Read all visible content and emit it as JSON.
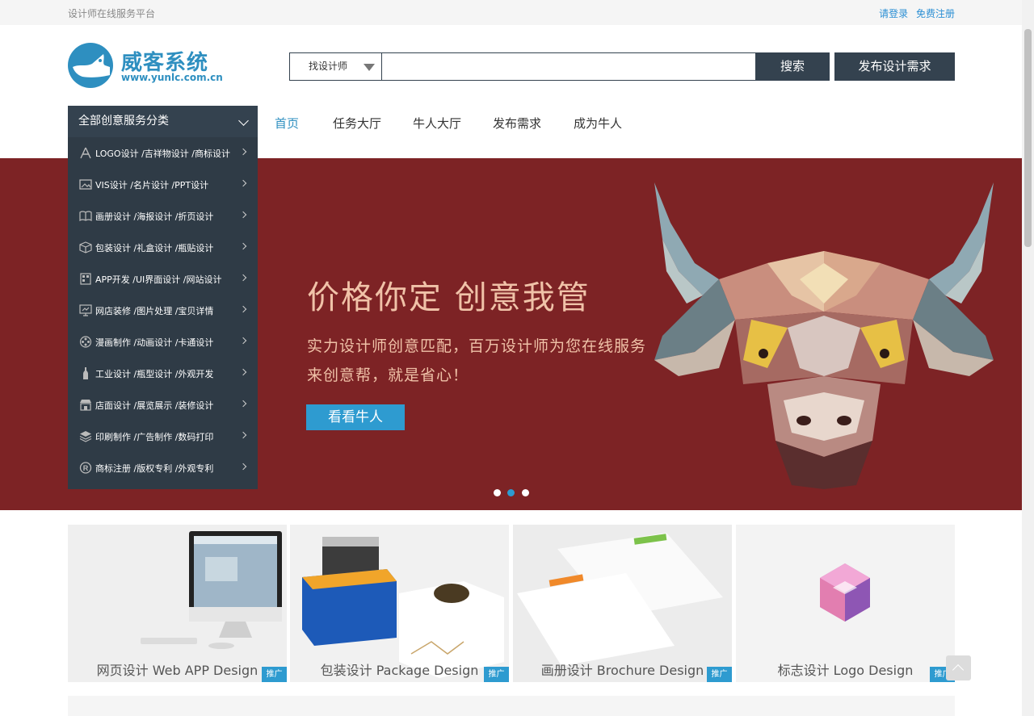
{
  "topbar": {
    "tagline": "设计师在线服务平台",
    "login": "请登录",
    "register": "免费注册"
  },
  "logo": {
    "title": "威客系统",
    "url": "www.yunlc.com.cn"
  },
  "search": {
    "type_selected": "找设计师",
    "value": "",
    "button": "搜索"
  },
  "publish_button": "发布设计需求",
  "nav": {
    "items": [
      "首页",
      "任务大厅",
      "牛人大厅",
      "发布需求",
      "成为牛人"
    ],
    "active": "首页"
  },
  "category": {
    "header": "全部创意服务分类",
    "items": [
      {
        "label": "LOGO设计 /吉祥物设计 /商标设计",
        "icon": "compass-icon"
      },
      {
        "label": "VIS设计 /名片设计 /PPT设计",
        "icon": "image-icon"
      },
      {
        "label": "画册设计 /海报设计 /折页设计",
        "icon": "book-icon"
      },
      {
        "label": "包装设计 /礼盒设计 /瓶贴设计",
        "icon": "package-icon"
      },
      {
        "label": "APP开发 /UI界面设计 /网站设计",
        "icon": "app-icon"
      },
      {
        "label": "网店装修 /图片处理 /宝贝详情",
        "icon": "monitor-icon"
      },
      {
        "label": "漫画制作 /动画设计 /卡通设计",
        "icon": "film-reel-icon"
      },
      {
        "label": "工业设计 /瓶型设计 /外观开发",
        "icon": "bottle-icon"
      },
      {
        "label": "店面设计 /展览展示 /装修设计",
        "icon": "storefront-icon"
      },
      {
        "label": "印刷制作 /广告制作 /数码打印",
        "icon": "layers-icon"
      },
      {
        "label": "商标注册 /版权专利 /外观专利",
        "icon": "registered-icon"
      }
    ]
  },
  "banner": {
    "headline": "价格你定 创意我管",
    "line1": "实力设计师创意匹配，百万设计师为您在线服务",
    "line2": "来创意帮，就是省心！",
    "button": "看看牛人",
    "slides": 3,
    "active_slide": 2,
    "background": "#7d2325"
  },
  "cards": [
    {
      "caption": "网页设计  Web APP Design",
      "tag": "推广"
    },
    {
      "caption": "包装设计  Package Design",
      "tag": "推广"
    },
    {
      "caption": "画册设计  Brochure Design",
      "tag": "推广"
    },
    {
      "caption": "标志设计  Logo Design",
      "tag": "推广"
    }
  ],
  "colors": {
    "accent": "#2e8fc0",
    "dark": "#34424f",
    "banner_button": "#2e9bd0"
  }
}
